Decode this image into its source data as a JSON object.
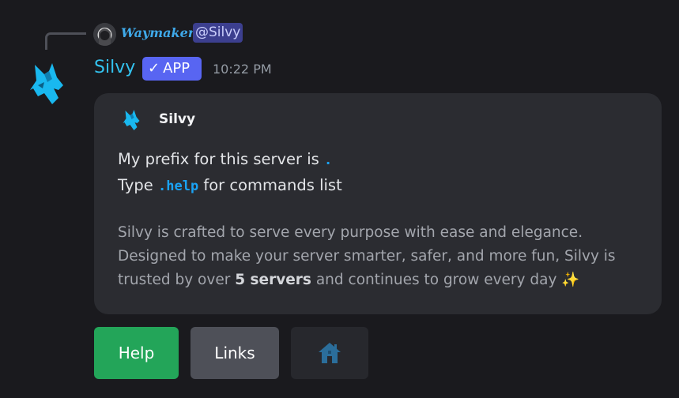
{
  "reply": {
    "author": "Waymaker",
    "mention": "@Silvy"
  },
  "message": {
    "author": "Silvy",
    "badge": "APP",
    "timestamp": "10:22 PM"
  },
  "embed": {
    "author_name": "Silvy",
    "prefix_text": "My prefix for this server is",
    "prefix_value": ".",
    "help_type": "Type",
    "help_command": ".help",
    "help_suffix": "for commands list",
    "about_line1": "Silvy is crafted to serve every purpose with ease and elegance.",
    "about_line2": "Designed to make your server smarter, safer, and more fun, Silvy is",
    "about_line3_pre": "trusted by over",
    "about_line3_bold": "5 servers",
    "about_line3_post": "and continues to grow every day",
    "sparkle": "✨"
  },
  "buttons": {
    "help": "Help",
    "links": "Links",
    "home_icon": "home-icon"
  },
  "colors": {
    "accent_name": "#33c3f0",
    "badge": "#5865f2",
    "help_button": "#23a559",
    "links_button": "#4e5058",
    "command": "#1aa3f5"
  }
}
